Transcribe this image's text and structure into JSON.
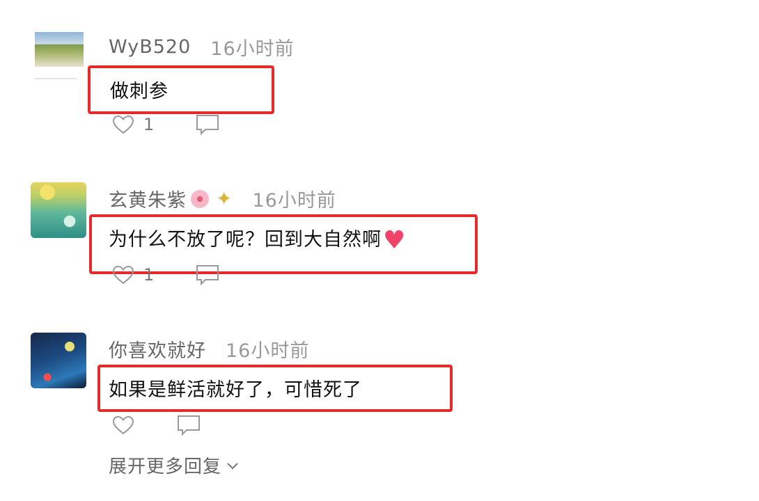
{
  "comments": [
    {
      "username": "WyB520",
      "time": "16小时前",
      "text": "做刺参",
      "likes": "1",
      "emoji_after_name": []
    },
    {
      "username": "玄黄朱紫",
      "time": "16小时前",
      "text": "为什么不放了呢？回到大自然啊",
      "likes": "1",
      "emoji_after_name": [
        "flower-emoji",
        "sparkles-emoji"
      ],
      "emoji_after_text": "heart-emoji"
    },
    {
      "username": "你喜欢就好",
      "time": "16小时前",
      "text": "如果是鲜活就好了，可惜死了",
      "likes": ""
    }
  ],
  "more_replies_label": "展开更多回复",
  "colors": {
    "highlight_border": "#e42a2a",
    "username": "#666666",
    "timestamp": "#999999",
    "comment_text": "#111111"
  },
  "icons": [
    "heart-outline-icon",
    "comment-bubble-icon",
    "chevron-down-icon"
  ]
}
